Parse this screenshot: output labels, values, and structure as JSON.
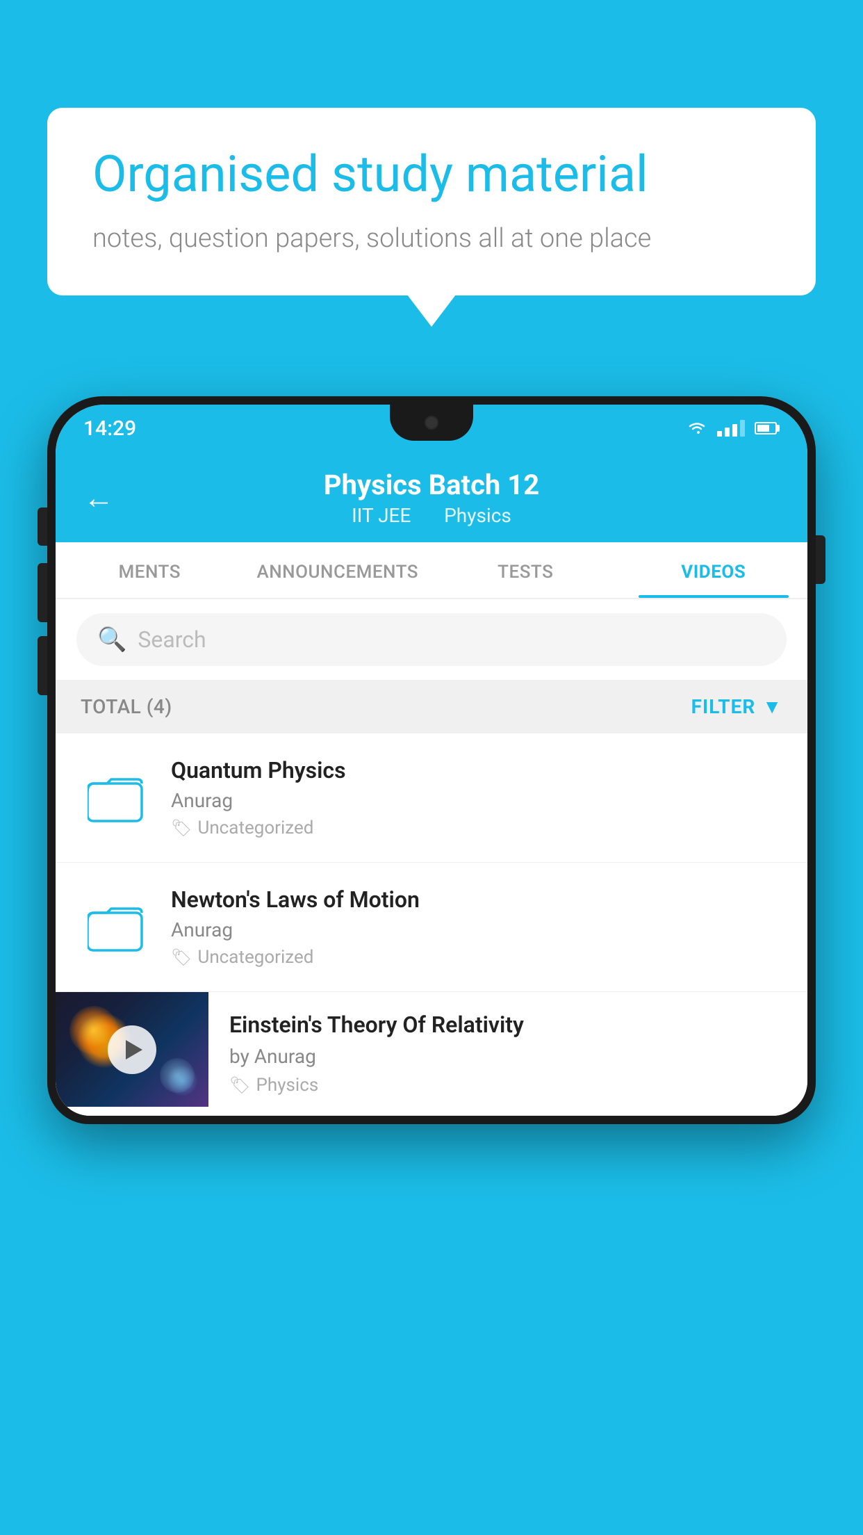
{
  "background_color": "#1BBDE8",
  "speech_bubble": {
    "heading": "Organised study material",
    "subtext": "notes, question papers, solutions all at one place"
  },
  "app": {
    "status_bar": {
      "time": "14:29"
    },
    "header": {
      "back_label": "←",
      "title": "Physics Batch 12",
      "subtitle_part1": "IIT JEE",
      "subtitle_part2": "Physics"
    },
    "tabs": [
      {
        "label": "MENTS",
        "active": false
      },
      {
        "label": "ANNOUNCEMENTS",
        "active": false
      },
      {
        "label": "TESTS",
        "active": false
      },
      {
        "label": "VIDEOS",
        "active": true
      }
    ],
    "search": {
      "placeholder": "Search"
    },
    "filter_bar": {
      "total_label": "TOTAL (4)",
      "filter_label": "FILTER"
    },
    "videos": [
      {
        "title": "Quantum Physics",
        "author": "Anurag",
        "tag": "Uncategorized",
        "has_thumbnail": false
      },
      {
        "title": "Newton's Laws of Motion",
        "author": "Anurag",
        "tag": "Uncategorized",
        "has_thumbnail": false
      },
      {
        "title": "Einstein's Theory Of Relativity",
        "author": "by Anurag",
        "tag": "Physics",
        "has_thumbnail": true
      }
    ]
  }
}
